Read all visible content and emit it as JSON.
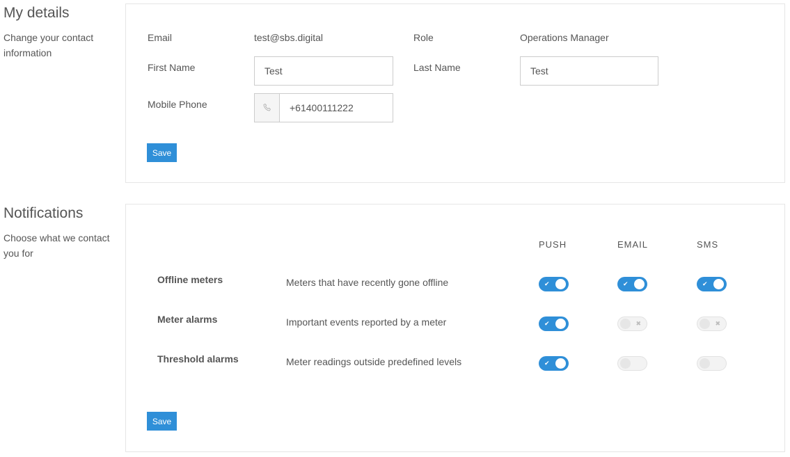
{
  "my_details": {
    "title": "My details",
    "description": "Change your contact information",
    "email_label": "Email",
    "email_value": "test@sbs.digital",
    "role_label": "Role",
    "role_value": "Operations Manager",
    "first_name_label": "First Name",
    "first_name_value": "Test",
    "last_name_label": "Last Name",
    "last_name_value": "Test",
    "mobile_phone_label": "Mobile Phone",
    "mobile_phone_value": "+61400111222",
    "phone_icon": "phone-icon",
    "save_label": "Save"
  },
  "notifications": {
    "title": "Notifications",
    "description": "Choose what we contact you for",
    "columns": [
      "PUSH",
      "EMAIL",
      "SMS"
    ],
    "rows": [
      {
        "name": "Offline meters",
        "description": "Meters that have recently gone offline",
        "push": true,
        "email": true,
        "sms": true
      },
      {
        "name": "Meter alarms",
        "description": "Important events reported by a meter",
        "push": true,
        "email": false,
        "sms": false
      },
      {
        "name": "Threshold alarms",
        "description": "Meter readings outside predefined levels",
        "push": true,
        "email": false,
        "sms": false
      }
    ],
    "save_label": "Save"
  },
  "colors": {
    "accent": "#2f8fd8",
    "text": "#555555",
    "border": "#e6e6e6"
  }
}
